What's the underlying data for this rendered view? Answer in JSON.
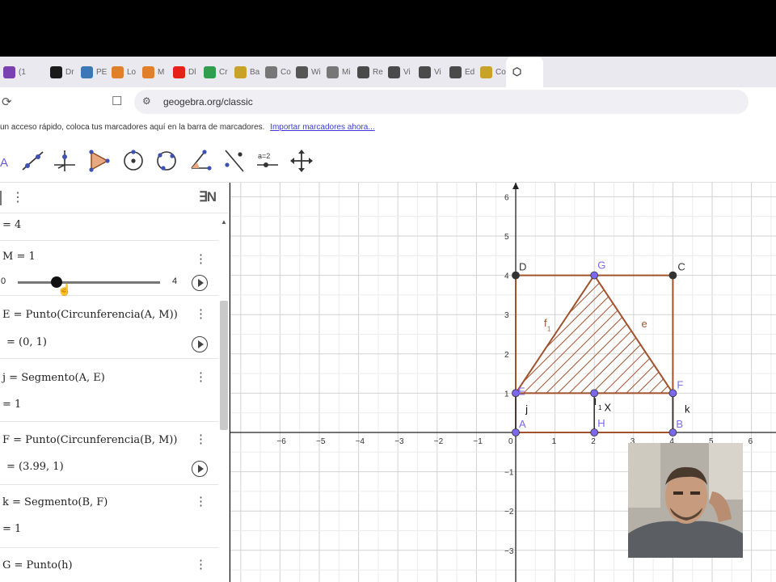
{
  "browser": {
    "tabs": [
      {
        "label": "(1",
        "icon": "mail-icon",
        "color": "#7a3fb0"
      },
      {
        "label": "Dr",
        "icon": "github-icon",
        "color": "#1a1a1a"
      },
      {
        "label": "PE",
        "icon": "python-icon",
        "color": "#3b78b5"
      },
      {
        "label": "Lo",
        "icon": "home-icon",
        "color": "#e0802b"
      },
      {
        "label": "M",
        "icon": "home-icon",
        "color": "#e0802b"
      },
      {
        "label": "Dl",
        "icon": "youtube-icon",
        "color": "#e62117"
      },
      {
        "label": "Cr",
        "icon": "drive-icon",
        "color": "#2f9e4f"
      },
      {
        "label": "Ba",
        "icon": "coin-icon",
        "color": "#c9a227"
      },
      {
        "label": "Co",
        "icon": "globe-icon",
        "color": "#777777"
      },
      {
        "label": "Wi",
        "icon": "wiki-icon",
        "color": "#555555"
      },
      {
        "label": "Mi",
        "icon": "globe-icon",
        "color": "#777777"
      },
      {
        "label": "Re",
        "icon": "compass-icon",
        "color": "#4a4a4a"
      },
      {
        "label": "Vi",
        "icon": "compass-icon",
        "color": "#4a4a4a"
      },
      {
        "label": "Vi",
        "icon": "compass-icon",
        "color": "#4a4a4a"
      },
      {
        "label": "Ed",
        "icon": "compass-icon",
        "color": "#4a4a4a"
      },
      {
        "label": "Co",
        "icon": "coin-icon",
        "color": "#c9a227"
      }
    ],
    "active_tab_icon": "geogebra-icon",
    "url": "geogebra.org/classic",
    "bookmarks_text": "un acceso rápido, coloca tus marcadores aquí en la barra de marcadores.",
    "bookmarks_link": "Importar marcadores ahora..."
  },
  "toolbar": {
    "tools": [
      {
        "name": "move-tool",
        "label": "A"
      },
      {
        "name": "line-tool",
        "label": ""
      },
      {
        "name": "perpendicular-tool",
        "label": ""
      },
      {
        "name": "polygon-tool",
        "label": ""
      },
      {
        "name": "circle-center-tool",
        "label": ""
      },
      {
        "name": "circle-three-points-tool",
        "label": ""
      },
      {
        "name": "angle-tool",
        "label": ""
      },
      {
        "name": "reflect-tool",
        "label": ""
      },
      {
        "name": "slider-tool",
        "label": "a=2"
      },
      {
        "name": "move-graphics-tool",
        "label": ""
      }
    ]
  },
  "algebra": {
    "sort_label": "∃N",
    "rows": [
      {
        "line1": "= 4",
        "line2": ""
      },
      {
        "line1": "M = 1",
        "slider_min": "0",
        "slider_max": "4",
        "slider_value": 1
      },
      {
        "line1": "E = Punto(Circunferencia(A, M))",
        "line2": "= (0, 1)"
      },
      {
        "line1": "j = Segmento(A, E)",
        "line2": "= 1"
      },
      {
        "line1": "F = Punto(Circunferencia(B, M))",
        "line2": "= (3.99, 1)"
      },
      {
        "line1": "k = Segmento(B, F)",
        "line2": "= 1"
      },
      {
        "line1": "G = Punto(h)",
        "line2": ""
      }
    ]
  },
  "graph": {
    "x_ticks": [
      "−6",
      "−5",
      "−4",
      "−3",
      "−2",
      "−1",
      "0",
      "1",
      "2",
      "3",
      "4",
      "5",
      "6"
    ],
    "y_ticks": [
      "6",
      "5",
      "4",
      "3",
      "2",
      "1",
      "−1",
      "−2",
      "−3"
    ],
    "square": {
      "A": [
        0,
        0
      ],
      "B": [
        4,
        0
      ],
      "C": [
        4,
        4
      ],
      "D": [
        0,
        4
      ]
    },
    "points": [
      {
        "label": "A",
        "x": 0,
        "y": 0,
        "color": "#7b68ee"
      },
      {
        "label": "B",
        "x": 4,
        "y": 0,
        "color": "#7b68ee"
      },
      {
        "label": "C",
        "x": 4,
        "y": 4,
        "color": "#333333"
      },
      {
        "label": "D",
        "x": 0,
        "y": 4,
        "color": "#333333"
      },
      {
        "label": "G",
        "x": 2,
        "y": 4,
        "color": "#7b68ee"
      },
      {
        "label": "E",
        "x": 0,
        "y": 1,
        "color": "#7b68ee"
      },
      {
        "label": "F",
        "x": 4,
        "y": 1,
        "color": "#7b68ee"
      },
      {
        "label": "H",
        "x": 2,
        "y": 0,
        "color": "#7b68ee"
      },
      {
        "label": "",
        "x": 2,
        "y": 1,
        "color": "#7b68ee"
      }
    ],
    "triangle": [
      [
        0,
        1
      ],
      [
        2,
        4
      ],
      [
        4,
        1
      ]
    ],
    "segment_labels": {
      "f1": "f",
      "f1_sub": "1",
      "e": "e",
      "j": "j",
      "k": "k",
      "l1": "l",
      "l1_sub": "1",
      "x": "X"
    },
    "colors": {
      "construction": "#a0522d",
      "hatch": "#a0522d",
      "point": "#7b68ee"
    }
  }
}
